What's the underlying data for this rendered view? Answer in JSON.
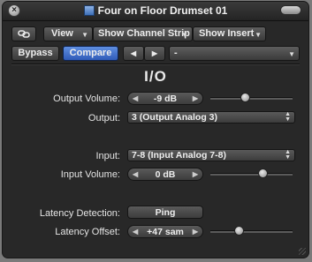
{
  "window": {
    "title": "Four on Floor Drumset 01"
  },
  "toolbar": {
    "view_label": "View",
    "show_channel_strip_label": "Show Channel Strip",
    "show_insert_label": "Show Insert"
  },
  "controls": {
    "bypass_label": "Bypass",
    "compare_label": "Compare",
    "preset_value": "-"
  },
  "plugin": {
    "title": "I/O",
    "output_volume": {
      "label": "Output Volume:",
      "value": "-9 dB",
      "slider_fraction": 0.42
    },
    "output": {
      "label": "Output:",
      "value": "3  (Output Analog 3)"
    },
    "input": {
      "label": "Input:",
      "value": "7-8  (Input Analog 7-8)"
    },
    "input_volume": {
      "label": "Input Volume:",
      "value": "0 dB",
      "slider_fraction": 0.64
    },
    "latency_detection": {
      "label": "Latency Detection:",
      "button_label": "Ping"
    },
    "latency_offset": {
      "label": "Latency Offset:",
      "value": "+47 sam",
      "slider_fraction": 0.35
    }
  },
  "colors": {
    "window_bg": "#282828",
    "compare_active": "#3b66c4",
    "desktop": "#7a7a7a"
  }
}
